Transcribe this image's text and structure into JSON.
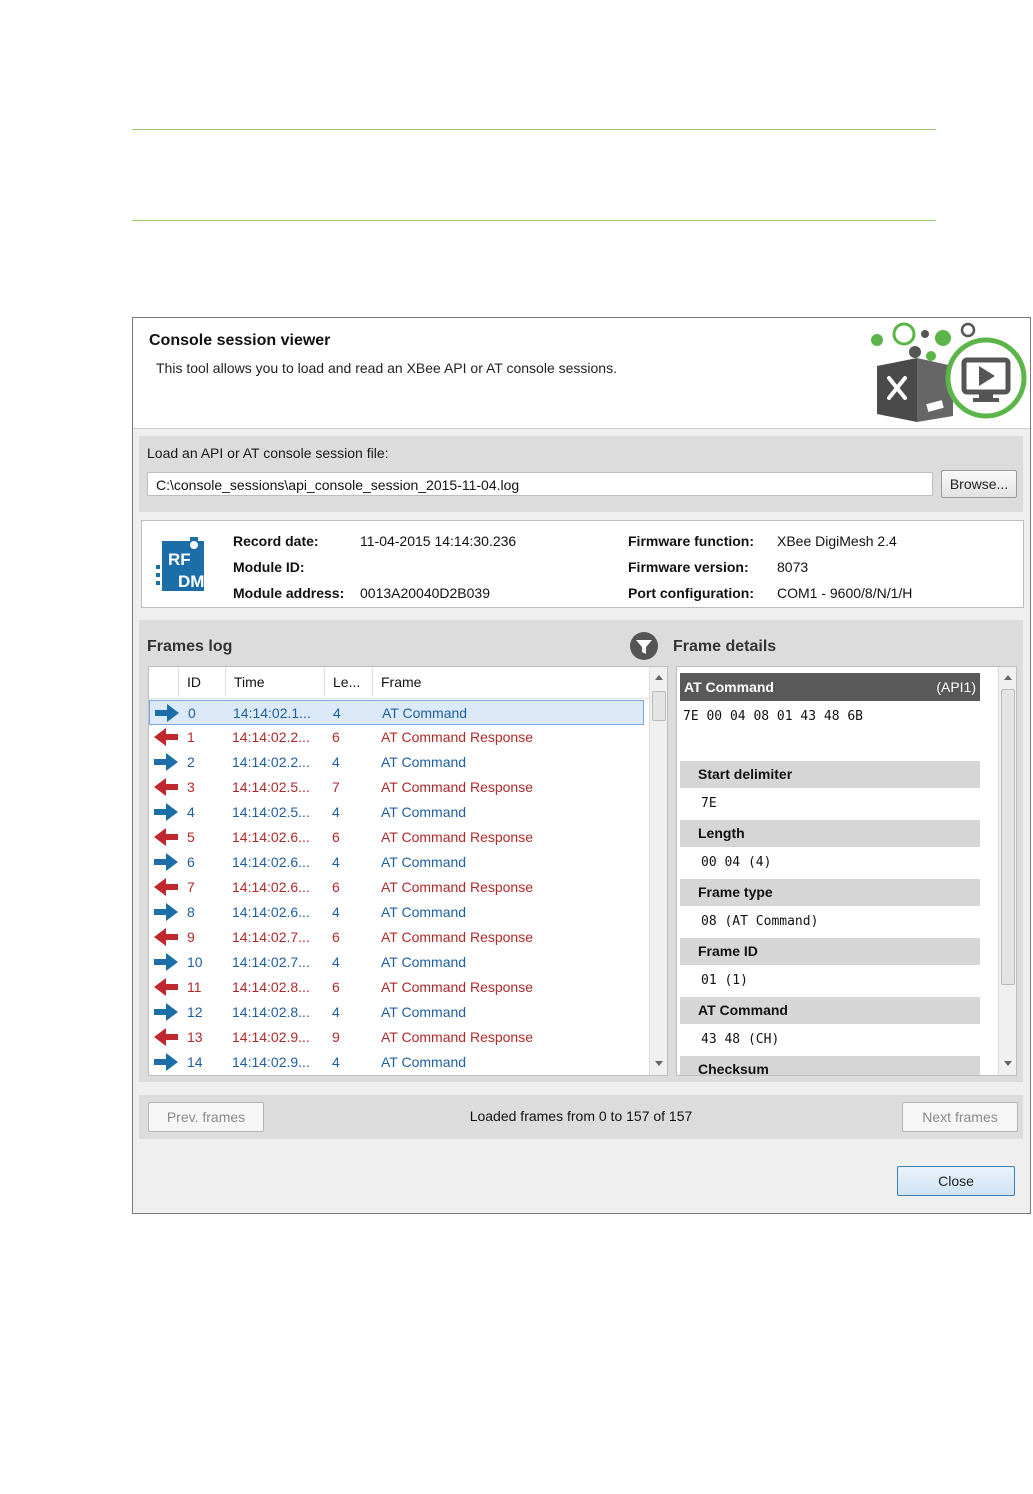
{
  "header": {
    "title": "Console session viewer",
    "description": "This tool allows you to load and read an XBee API or AT console sessions."
  },
  "load": {
    "label": "Load an API or AT console session file:",
    "path": "C:\\console_sessions\\api_console_session_2015-11-04.log",
    "browse_label": "Browse..."
  },
  "info": {
    "logo_text_top": "RF",
    "logo_text_bottom": "DM",
    "record_date_label": "Record date:",
    "record_date": "11-04-2015 14:14:30.236",
    "module_id_label": "Module ID:",
    "module_id": "",
    "module_address_label": "Module address:",
    "module_address": "0013A20040D2B039",
    "fw_function_label": "Firmware function:",
    "fw_function": "XBee DigiMesh 2.4",
    "fw_version_label": "Firmware version:",
    "fw_version": "8073",
    "port_label": "Port configuration:",
    "port": "COM1 - 9600/8/N/1/H"
  },
  "frames_log": {
    "title": "Frames log",
    "columns": [
      "ID",
      "Time",
      "Le...",
      "Frame"
    ],
    "rows": [
      {
        "dir": "out",
        "id": "0",
        "time": "14:14:02.1...",
        "len": "4",
        "frame": "AT Command",
        "selected": true
      },
      {
        "dir": "in",
        "id": "1",
        "time": "14:14:02.2...",
        "len": "6",
        "frame": "AT Command Response"
      },
      {
        "dir": "out",
        "id": "2",
        "time": "14:14:02.2...",
        "len": "4",
        "frame": "AT Command"
      },
      {
        "dir": "in",
        "id": "3",
        "time": "14:14:02.5...",
        "len": "7",
        "frame": "AT Command Response"
      },
      {
        "dir": "out",
        "id": "4",
        "time": "14:14:02.5...",
        "len": "4",
        "frame": "AT Command"
      },
      {
        "dir": "in",
        "id": "5",
        "time": "14:14:02.6...",
        "len": "6",
        "frame": "AT Command Response"
      },
      {
        "dir": "out",
        "id": "6",
        "time": "14:14:02.6...",
        "len": "4",
        "frame": "AT Command"
      },
      {
        "dir": "in",
        "id": "7",
        "time": "14:14:02.6...",
        "len": "6",
        "frame": "AT Command Response"
      },
      {
        "dir": "out",
        "id": "8",
        "time": "14:14:02.6...",
        "len": "4",
        "frame": "AT Command"
      },
      {
        "dir": "in",
        "id": "9",
        "time": "14:14:02.7...",
        "len": "6",
        "frame": "AT Command Response"
      },
      {
        "dir": "out",
        "id": "10",
        "time": "14:14:02.7...",
        "len": "4",
        "frame": "AT Command"
      },
      {
        "dir": "in",
        "id": "11",
        "time": "14:14:02.8...",
        "len": "6",
        "frame": "AT Command Response"
      },
      {
        "dir": "out",
        "id": "12",
        "time": "14:14:02.8...",
        "len": "4",
        "frame": "AT Command"
      },
      {
        "dir": "in",
        "id": "13",
        "time": "14:14:02.9...",
        "len": "9",
        "frame": "AT Command Response"
      },
      {
        "dir": "out",
        "id": "14",
        "time": "14:14:02.9...",
        "len": "4",
        "frame": "AT Command"
      }
    ]
  },
  "frame_details": {
    "title": "Frame details",
    "header_name": "AT Command",
    "header_api": "(API1)",
    "hex": "7E 00 04 08 01 43 48 6B",
    "fields": [
      {
        "name": "Start delimiter",
        "value": "7E"
      },
      {
        "name": "Length",
        "value": "00 04 (4)"
      },
      {
        "name": "Frame type",
        "value": "08 (AT Command)"
      },
      {
        "name": "Frame ID",
        "value": "01 (1)"
      },
      {
        "name": "AT Command",
        "value": "43 48 (CH)"
      },
      {
        "name": "Checksum",
        "value": ""
      }
    ]
  },
  "pager": {
    "prev_label": "Prev. frames",
    "info": "Loaded frames from 0 to 157 of 157",
    "next_label": "Next frames"
  },
  "close_label": "Close",
  "colors": {
    "out_arrow": "#1c6ea8",
    "in_arrow": "#c0282d",
    "out_text": "#1f5fa0",
    "in_text": "#b02a2a",
    "accent_green": "#5bb548",
    "rule_green": "#9ccc65"
  }
}
